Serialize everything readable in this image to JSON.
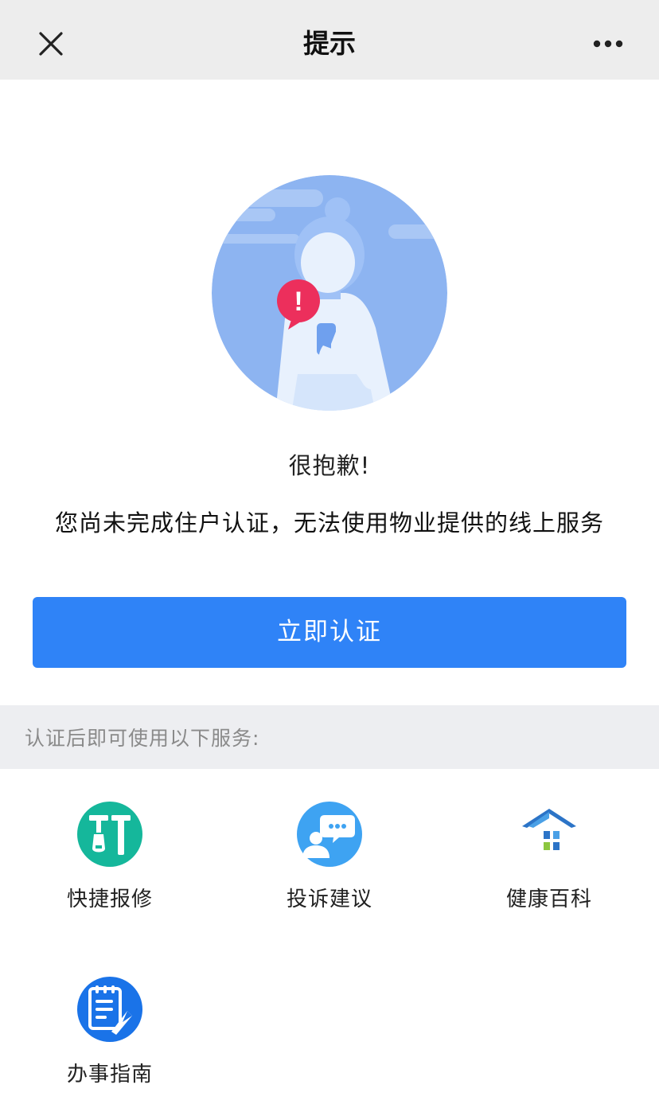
{
  "navbar": {
    "title": "提示",
    "close_icon": "close-icon",
    "more_icon": "more-icon"
  },
  "hero": {
    "illustration": "person-holding-phone-with-alert",
    "alert_symbol": "!"
  },
  "notice": {
    "sorry": "很抱歉!",
    "message": "您尚未完成住户认证，无法使用物业提供的线上服务"
  },
  "verify_button": {
    "label": "立即认证",
    "color": "#2f83f7"
  },
  "services_section": {
    "title": "认证后即可使用以下服务:",
    "items": [
      {
        "label": "快捷报修",
        "icon": "repair-tools-icon",
        "color": "#15b79b"
      },
      {
        "label": "投诉建议",
        "icon": "complaint-chat-icon",
        "color": "#3ea3f2"
      },
      {
        "label": "健康百科",
        "icon": "health-house-icon",
        "color": "#2c74c7"
      },
      {
        "label": "办事指南",
        "icon": "guide-clipboard-icon",
        "color": "#1a73e8"
      }
    ]
  }
}
